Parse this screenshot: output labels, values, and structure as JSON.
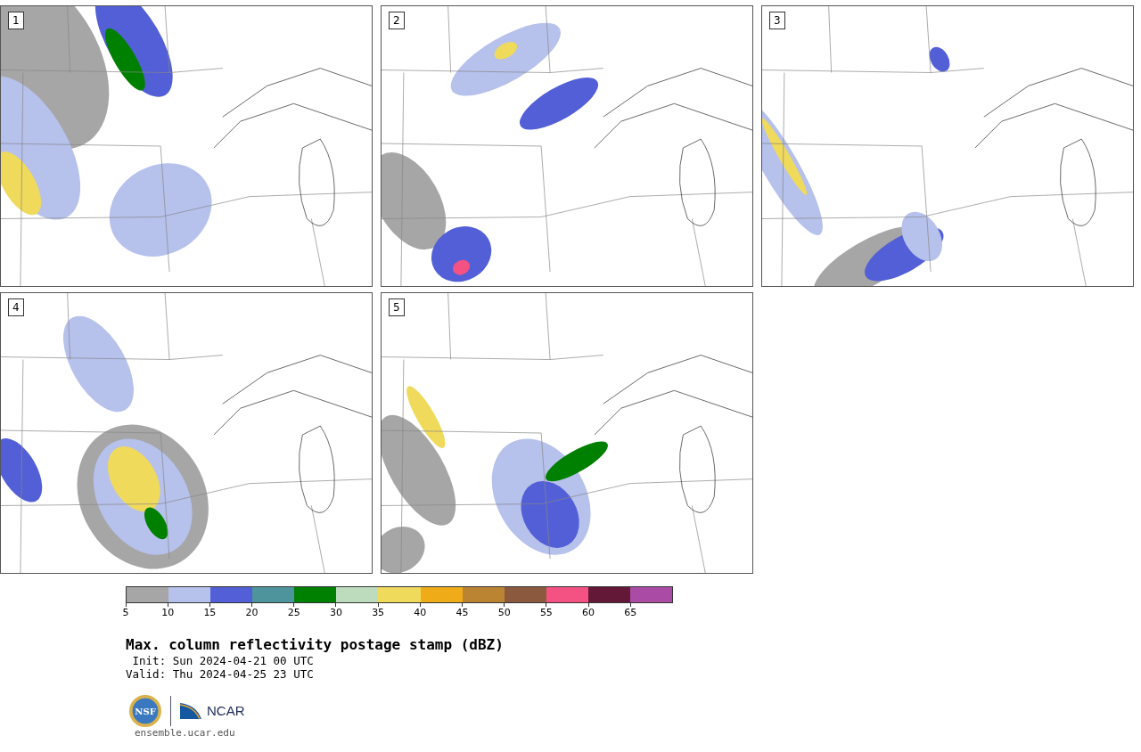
{
  "panels": [
    {
      "number": "1"
    },
    {
      "number": "2"
    },
    {
      "number": "3"
    },
    {
      "number": "4"
    },
    {
      "number": "5"
    }
  ],
  "colorbar": {
    "segments": [
      {
        "color": "#a6a6a6"
      },
      {
        "color": "#b6c1ec"
      },
      {
        "color": "#525fd6"
      },
      {
        "color": "#4e949c"
      },
      {
        "color": "#008000"
      },
      {
        "color": "#bddcbd"
      },
      {
        "color": "#f0da5c"
      },
      {
        "color": "#f0ac18"
      },
      {
        "color": "#bb8433"
      },
      {
        "color": "#8b5a3e"
      },
      {
        "color": "#f45282"
      },
      {
        "color": "#641838"
      },
      {
        "color": "#aa4ca6"
      }
    ],
    "ticks": [
      "5",
      "10",
      "15",
      "20",
      "25",
      "30",
      "35",
      "40",
      "45",
      "50",
      "55",
      "60",
      "65"
    ]
  },
  "title": "Max. column reflectivity postage stamp (dBZ)",
  "init": " Init: Sun 2024-04-21 00 UTC",
  "valid": "Valid: Thu 2024-04-25 23 UTC",
  "logos": {
    "nsf": "NSF",
    "ncar": "NCAR"
  },
  "url": "ensemble.ucar.edu"
}
